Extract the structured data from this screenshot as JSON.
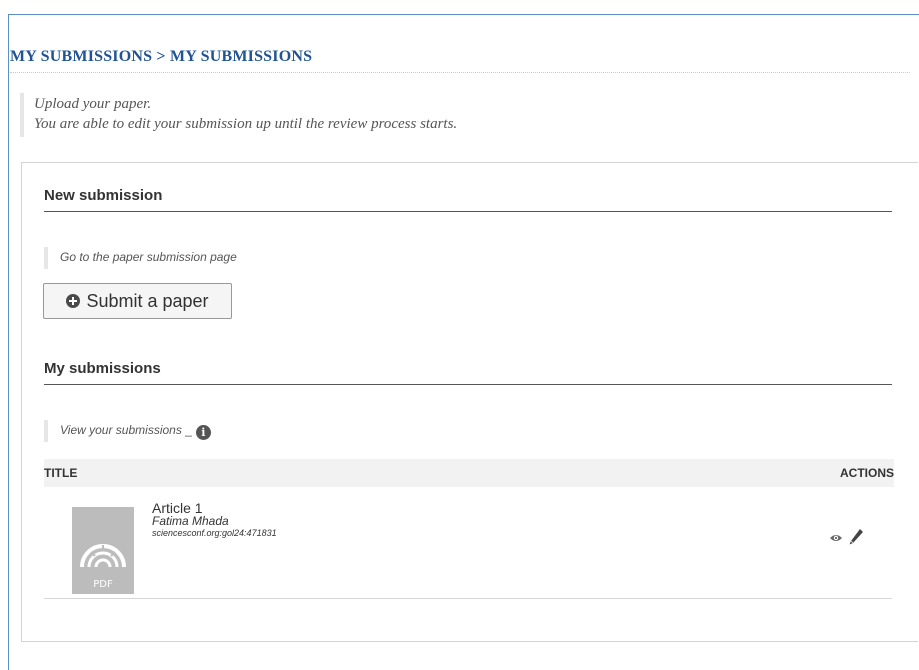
{
  "page": {
    "heading": "MY SUBMISSIONS > MY SUBMISSIONS",
    "intro_line1": "Upload your paper.",
    "intro_line2": "You are able to edit your submission up until the review process starts."
  },
  "new_submission": {
    "title": "New submission",
    "hint": "Go to the paper submission page",
    "button_label": "Submit a paper"
  },
  "my_submissions": {
    "title": "My submissions",
    "hint": "View your submissions",
    "hint_suffix": "_",
    "info_icon_glyph": "i",
    "columns": {
      "title": "TITLE",
      "actions": "ACTIONS"
    },
    "items": [
      {
        "title": "Article 1",
        "author": "Fatima Mhada",
        "identifier": "sciencesconf.org:gol24:471831",
        "thumb_label": "PDF"
      }
    ]
  },
  "icons": {
    "submit": "plus-circle-icon",
    "info": "info-icon",
    "view": "eye-icon",
    "edit": "pencil-icon",
    "thumb": "pdf-icon"
  },
  "colors": {
    "heading": "#1f5391",
    "frame_border": "#5b8fc7",
    "thumb_bg": "#bcbcbc"
  }
}
